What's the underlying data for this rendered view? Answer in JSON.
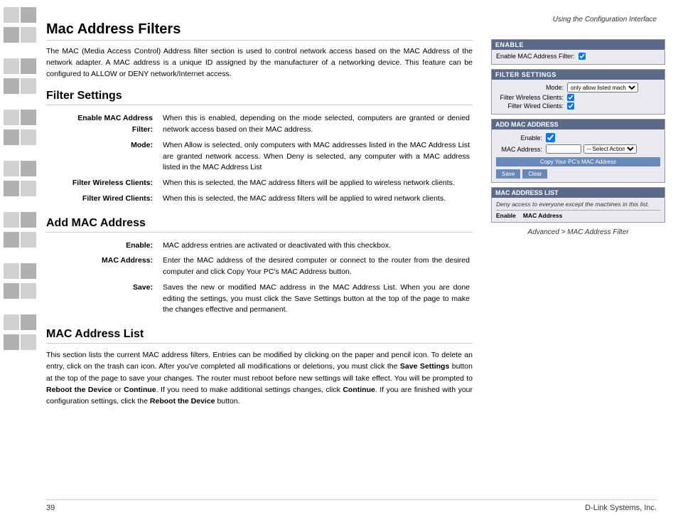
{
  "header": {
    "top_right": "Using the Configuration Interface"
  },
  "page": {
    "main_title": "Mac Address Filters",
    "intro": "The MAC (Media Access Control) Address filter section is used to control network access based on the MAC Address of the network adapter. A MAC address is a unique ID assigned by the manufacturer of a networking device. This feature can be configured to ALLOW or DENY network/Internet access.",
    "filter_settings_title": "Filter Settings",
    "filter_settings_rows": [
      {
        "label": "Enable MAC Address Filter:",
        "desc": "When this is enabled, depending on the mode selected, computers are granted or denied network access based on their MAC address."
      },
      {
        "label": "Mode:",
        "desc": "When Allow is selected, only computers with MAC addresses listed in the MAC Address List are granted network access. When Deny is selected, any computer with a MAC address listed in the MAC Address List"
      },
      {
        "label": "Filter Wireless Clients:",
        "desc": "When this is selected, the MAC address filters will be applied to wireless network clients."
      },
      {
        "label": "Filter Wired Clients:",
        "desc": "When this is selected, the MAC address filters will be applied to wired network clients."
      }
    ],
    "add_mac_title": "Add MAC Address",
    "add_mac_rows": [
      {
        "label": "Enable:",
        "desc": "MAC address entries are activated or deactivated with this checkbox."
      },
      {
        "label": "MAC Address:",
        "desc": "Enter the MAC address of the desired computer or connect to the router from the desired computer and click Copy Your PC's MAC Address button."
      },
      {
        "label": "Save:",
        "desc": "Saves the new or modified MAC address in the MAC Address List. When you are done editing the settings, you must click the Save Settings button at the top of the page to make the changes effective and permanent."
      }
    ],
    "mac_address_list_title": "MAC Address List",
    "mac_address_list_text": "This section lists the current MAC address filters. Entries can be modified by clicking on the paper and pencil icon. To delete an entry, click on the trash can icon. After you've completed all modifications or deletions, you must click the Save Settings button at the top of the page to save your changes. The router must reboot before new settings will take effect. You will be prompted to Reboot the Device or Continue. If you need to make additional settings changes, click Continue. If you are finished with your configuration settings, click the Reboot the Device button."
  },
  "right_panel": {
    "enable_section": {
      "header": "ENABLE",
      "row_label": "Enable MAC Address Filter:",
      "checkbox_checked": true
    },
    "filter_settings": {
      "header": "FILTER SETTINGS",
      "mode_label": "Mode:",
      "mode_value": "only allow listed machines",
      "filter_wireless_label": "Filter Wireless Clients:",
      "filter_wireless_checked": true,
      "filter_wired_label": "Filter Wired Clients:",
      "filter_wired_checked": true
    },
    "add_mac_address": {
      "header": "ADD MAC ADDRESS",
      "enable_label": "Enable:",
      "enable_checked": true,
      "mac_address_label": "MAC Address:",
      "mac_value": "",
      "mac_placeholder": "",
      "select_placeholder": "-- Select Action --",
      "copy_btn_label": "Copy Your PC's MAC Address",
      "save_btn_label": "Save",
      "clear_btn_label": "Clear"
    },
    "mac_address_list": {
      "header": "MAC ADDRESS LIST",
      "desc": "Deny access to everyone except the machines in this list.",
      "col1": "Enable",
      "col2": "MAC Address"
    },
    "caption": "Advanced > MAC Address Filter"
  },
  "footer": {
    "page_number": "39",
    "company": "D-Link Systems, Inc."
  },
  "decorations": {
    "blocks": [
      {
        "rows": 3
      },
      {
        "rows": 3
      },
      {
        "rows": 3
      },
      {
        "rows": 3
      },
      {
        "rows": 3
      },
      {
        "rows": 3
      },
      {
        "rows": 3
      }
    ]
  }
}
